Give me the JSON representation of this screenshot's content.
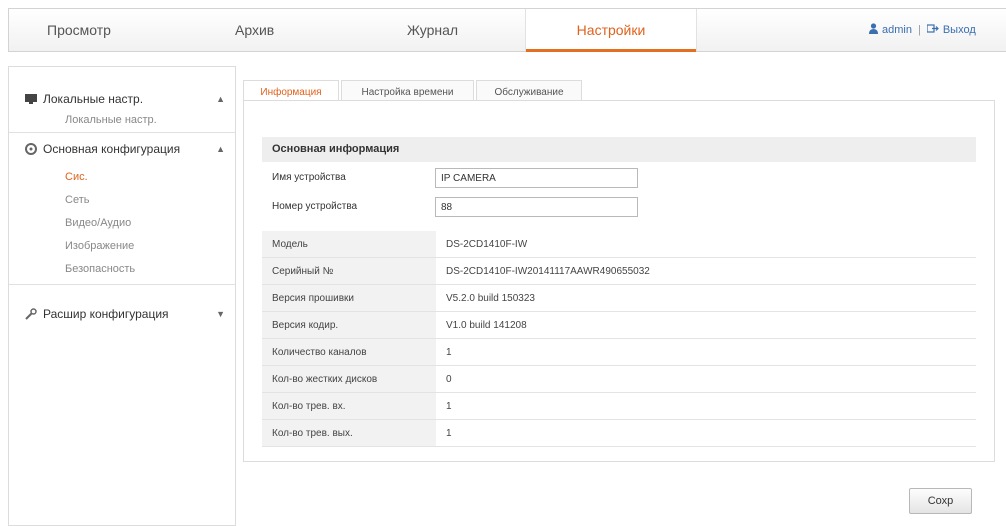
{
  "nav": {
    "tabs": [
      {
        "label": "Просмотр"
      },
      {
        "label": "Архив"
      },
      {
        "label": "Журнал"
      },
      {
        "label": "Настройки"
      }
    ],
    "user": "admin",
    "separator": "|",
    "logout": "Выход"
  },
  "sidebar": {
    "groups": [
      {
        "label": "Локальные настр.",
        "arrow": "▲",
        "items": [
          "Локальные настр."
        ]
      },
      {
        "label": "Основная конфигурация",
        "arrow": "▲",
        "items": [
          "Сис.",
          "Сеть",
          "Видео/Аудио",
          "Изображение",
          "Безопасность"
        ]
      },
      {
        "label": "Расшир конфигурация",
        "arrow": "▼"
      }
    ]
  },
  "subtabs": [
    "Информация",
    "Настройка времени",
    "Обслуживание"
  ],
  "section_title": "Основная информация",
  "device_name": {
    "label": "Имя устройства",
    "value": "IP CAMERA"
  },
  "device_number": {
    "label": "Номер устройства",
    "value": "88"
  },
  "info_rows": [
    {
      "key": "Модель",
      "value": "DS-2CD1410F-IW"
    },
    {
      "key": "Серийный №",
      "value": "DS-2CD1410F-IW20141117AAWR490655032"
    },
    {
      "key": "Версия прошивки",
      "value": "V5.2.0 build 150323"
    },
    {
      "key": "Версия кодир.",
      "value": "V1.0 build 141208"
    },
    {
      "key": "Количество каналов",
      "value": "1"
    },
    {
      "key": "Кол-во жестких дисков",
      "value": "0"
    },
    {
      "key": "Кол-во трев. вх.",
      "value": "1"
    },
    {
      "key": "Кол-во трев. вых.",
      "value": "1"
    }
  ],
  "save_label": "Сохр",
  "colors": {
    "accent": "#e56e1f",
    "link": "#3a6fb0",
    "section_bg": "#eeeeee"
  }
}
